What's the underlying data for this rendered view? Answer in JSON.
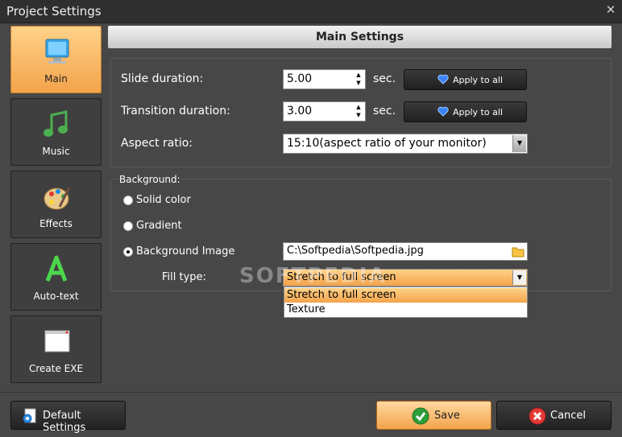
{
  "window": {
    "title": "Project Settings",
    "close_glyph": "✕"
  },
  "sidebar": {
    "items": [
      {
        "label": "Main",
        "icon": "monitor-icon",
        "active": true
      },
      {
        "label": "Music",
        "icon": "music-note-icon"
      },
      {
        "label": "Effects",
        "icon": "palette-icon"
      },
      {
        "label": "Auto-text",
        "icon": "letter-a-icon"
      },
      {
        "label": "Create EXE",
        "icon": "window-icon"
      }
    ]
  },
  "main": {
    "header": "Main Settings",
    "slide_duration": {
      "label": "Slide duration:",
      "value": "5.00",
      "unit": "sec.",
      "apply_label": "Apply to all"
    },
    "transition_duration": {
      "label": "Transition duration:",
      "value": "3.00",
      "unit": "sec.",
      "apply_label": "Apply to all"
    },
    "aspect_ratio": {
      "label": "Aspect ratio:",
      "value": "15:10(aspect ratio of your monitor)"
    },
    "background": {
      "group_label": "Background:",
      "options": [
        "Solid color",
        "Gradient",
        "Background Image"
      ],
      "selected_option": "Background Image",
      "image_path": "C:\\Softpedia\\Softpedia.jpg",
      "fill_type_label": "Fill type:",
      "fill_type_value": "Stretch to full screen",
      "fill_type_options": [
        "Stretch to full screen",
        "Texture"
      ]
    }
  },
  "watermark": "SOFTPEDIA",
  "footer": {
    "default_settings": "Default Settings",
    "save": "Save",
    "cancel": "Cancel"
  },
  "colors": {
    "accent": "#f3a34a",
    "background": "#474747"
  }
}
